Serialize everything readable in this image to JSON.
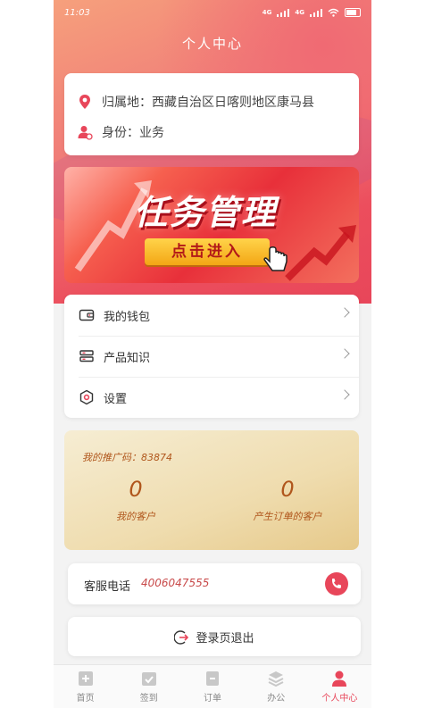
{
  "status_bar": {
    "time": "11:03",
    "network": "4G"
  },
  "page": {
    "title": "个人中心"
  },
  "profile": {
    "location_label": "归属地：",
    "location_value": "西藏自治区日喀则地区康马县",
    "role_label": "身份：",
    "role_value": "业务"
  },
  "banner": {
    "title": "任务管理",
    "button": "点击进入"
  },
  "menu": [
    {
      "label": "我的钱包",
      "icon": "wallet-icon"
    },
    {
      "label": "产品知识",
      "icon": "stack-icon"
    },
    {
      "label": "设置",
      "icon": "gear-icon"
    }
  ],
  "promo": {
    "code_label": "我的推广码：",
    "code_value": "83874",
    "my_customers_count": "0",
    "my_customers_label": "我的客户",
    "order_customers_count": "0",
    "order_customers_label": "产生订单的客户"
  },
  "service": {
    "label": "客服电话",
    "phone": "4006047555"
  },
  "logout": {
    "label": "登录页退出"
  },
  "tabs": [
    {
      "label": "首页",
      "icon": "home-icon"
    },
    {
      "label": "签到",
      "icon": "checkin-icon"
    },
    {
      "label": "订单",
      "icon": "order-icon"
    },
    {
      "label": "办公",
      "icon": "office-icon"
    },
    {
      "label": "个人中心",
      "icon": "person-icon",
      "active": true
    }
  ],
  "colors": {
    "accent": "#e8465a",
    "promo_text": "#b0561c"
  }
}
